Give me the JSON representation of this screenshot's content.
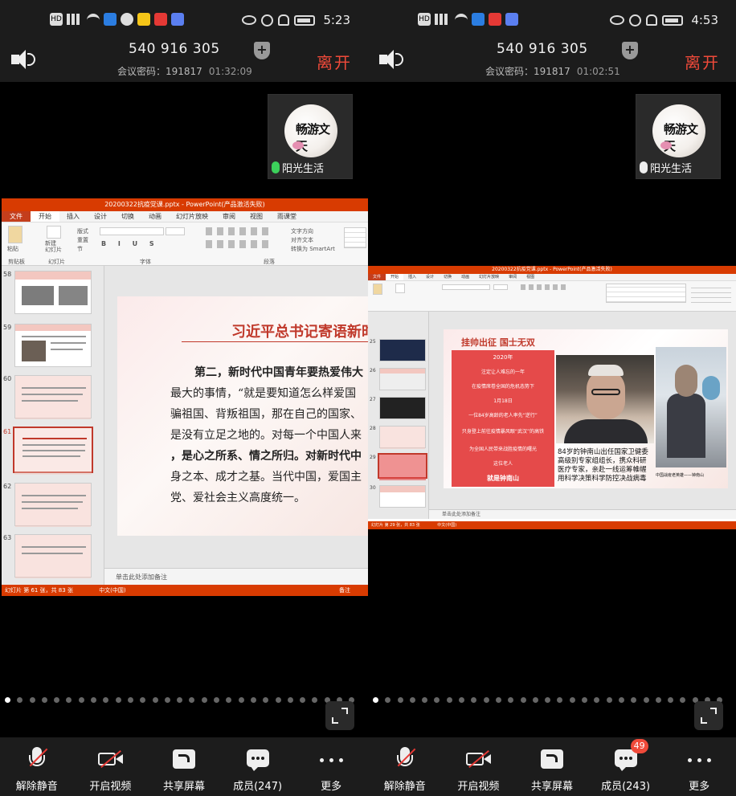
{
  "left_phone": {
    "status_bar": {
      "time": "5:23",
      "hd": "HD"
    },
    "meeting": {
      "id": "540 916 305",
      "password": "会议密码：191817",
      "duration": "01:32:09",
      "leave": "离开"
    },
    "participant": {
      "name": "阳光生活",
      "avatar_text": "畅游文天"
    },
    "ppt": {
      "title": "20200322抗疫党课.pptx - PowerPoint(产品激活失败)",
      "tabs": [
        "文件",
        "开始",
        "插入",
        "设计",
        "切换",
        "动画",
        "幻灯片放映",
        "审阅",
        "视图",
        "雨课堂"
      ],
      "ribbon_labels": {
        "paste": "粘贴",
        "new_slide": "新建\n幻灯片",
        "clipboard": "剪贴板",
        "slides": "幻灯片",
        "font": "字体",
        "paragraph": "段落",
        "layout": "版式",
        "reset": "重置",
        "section": "节",
        "text_direction": "文字方向",
        "align_text": "对齐文本",
        "smartart": "转换为 SmartArt"
      },
      "thumb_numbers": [
        "58",
        "59",
        "60",
        "61",
        "62",
        "63"
      ],
      "slide": {
        "title": "习近平总书记寄语新时代青年",
        "lines": [
          "第二，新时代中国青年要热爱伟大",
          "最大的事情，“就是要知道怎么样爱国",
          "骗祖国、背叛祖国，那在自己的国家、",
          "是没有立足之地的。对每一个中国人来",
          "，是心之所系、情之所归。对新时代中",
          "身之本、成才之基。当代中国，爱国主",
          "党、爱社会主义高度统一。"
        ]
      },
      "notes": "单击此处添加备注",
      "status": {
        "slide_count": "幻灯片 第 61 张，共 83 张",
        "language": "中文(中国)",
        "notes_btn": "备注"
      }
    }
  },
  "right_phone": {
    "status_bar": {
      "time": "4:53",
      "hd": "HD"
    },
    "meeting": {
      "id": "540 916 305",
      "password": "会议密码：191817",
      "duration": "01:02:51",
      "leave": "离开"
    },
    "participant": {
      "name": "阳光生活",
      "avatar_text": "畅游文天"
    },
    "ppt": {
      "title": "20200322抗疫党课.pptx - PowerPoint(产品激活失败)",
      "thumb_numbers": [
        "25",
        "26",
        "27",
        "28",
        "29",
        "30"
      ],
      "slide": {
        "title": "挂帅出征   国士无双",
        "panel_lines": [
          "2020年",
          "注定让人难忘的一年",
          "在疫情席卷全国的危机态势下",
          "1月18日",
          "一位84岁高龄的老人率先“逆行”",
          "只身登上前往疫情暴风眼“武汉”的高铁",
          "为全国人民带来战胜疫情的曙光",
          "这位老人",
          "就是钟南山"
        ],
        "caption_lines": [
          "84岁的钟南山出任国家卫健委",
          "高级别专家组组长，携众科研",
          "医疗专家，亲赴一线运筹帷幄",
          "用科学决策科学防控决战病毒"
        ],
        "photo_caption": "中国战疫老英雄——钟南山"
      },
      "notes": "单击此处添加备注",
      "status": {
        "slide_count": "幻灯片 第 29 张，共 83 张",
        "language": "中文(中国)"
      }
    }
  },
  "toolbar": {
    "left": [
      "解除静音",
      "开启视频",
      "共享屏幕",
      "成员(247)",
      "更多"
    ],
    "right": [
      "解除静音",
      "开启视频",
      "共享屏幕",
      "成员(243)",
      "更多"
    ],
    "right_badge": "49"
  },
  "colors": {
    "accent_red": "#f04a3a",
    "ppt_orange": "#d83b01",
    "mic_green": "#3cd15b"
  }
}
